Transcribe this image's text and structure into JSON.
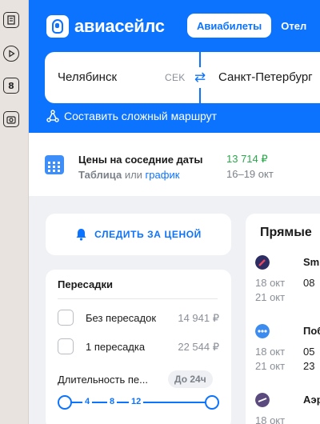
{
  "browser_rail": {
    "icons": [
      "notes-icon",
      "play-icon",
      "number-8-icon",
      "screenshot-icon"
    ],
    "number_label": "8"
  },
  "header": {
    "brand": "авиасейлс",
    "tabs": [
      {
        "label": "Авиабилеты",
        "active": true
      },
      {
        "label": "Отел",
        "active": false
      }
    ],
    "colors": {
      "brand_blue": "#0c73fe"
    }
  },
  "search": {
    "from_city": "Челябинск",
    "from_code": "CEK",
    "to_city": "Санкт-Петербург",
    "complex_route_label": "Составить сложный маршрут"
  },
  "nearby_dates": {
    "title": "Цены на соседние даты",
    "table_link": "Таблица",
    "or_text": "или",
    "chart_link": "график",
    "price": "13 714 ₽",
    "range": "16–19 окт"
  },
  "follow_price": {
    "label": "СЛЕДИТЬ ЗА ЦЕНОЙ"
  },
  "filters": {
    "stops_title": "Пересадки",
    "options": [
      {
        "label": "Без пересадок",
        "price": "14 941 ₽",
        "checked": false
      },
      {
        "label": "1 пересадка",
        "price": "22 544 ₽",
        "checked": false
      }
    ],
    "duration_label": "Длительность пе...",
    "duration_badge": "До 24ч",
    "slider_ticks": [
      "4",
      "8",
      "12"
    ]
  },
  "direct_flights": {
    "title": "Прямые",
    "flights": [
      {
        "airline": "Sm",
        "date_out": "18 окт",
        "time_out": "08",
        "date_back": "21 окт",
        "time_back": "",
        "logo_color": "#2b2d63"
      },
      {
        "airline": "Поб",
        "date_out": "18 окт",
        "time_out": "05",
        "date_back": "21 окт",
        "time_back": "23",
        "logo_color": "#3c8cf0"
      },
      {
        "airline": "Аэр",
        "date_out": "18 окт",
        "time_out": "",
        "date_back": "",
        "time_back": "",
        "logo_color": "#5b4a7e"
      }
    ]
  }
}
